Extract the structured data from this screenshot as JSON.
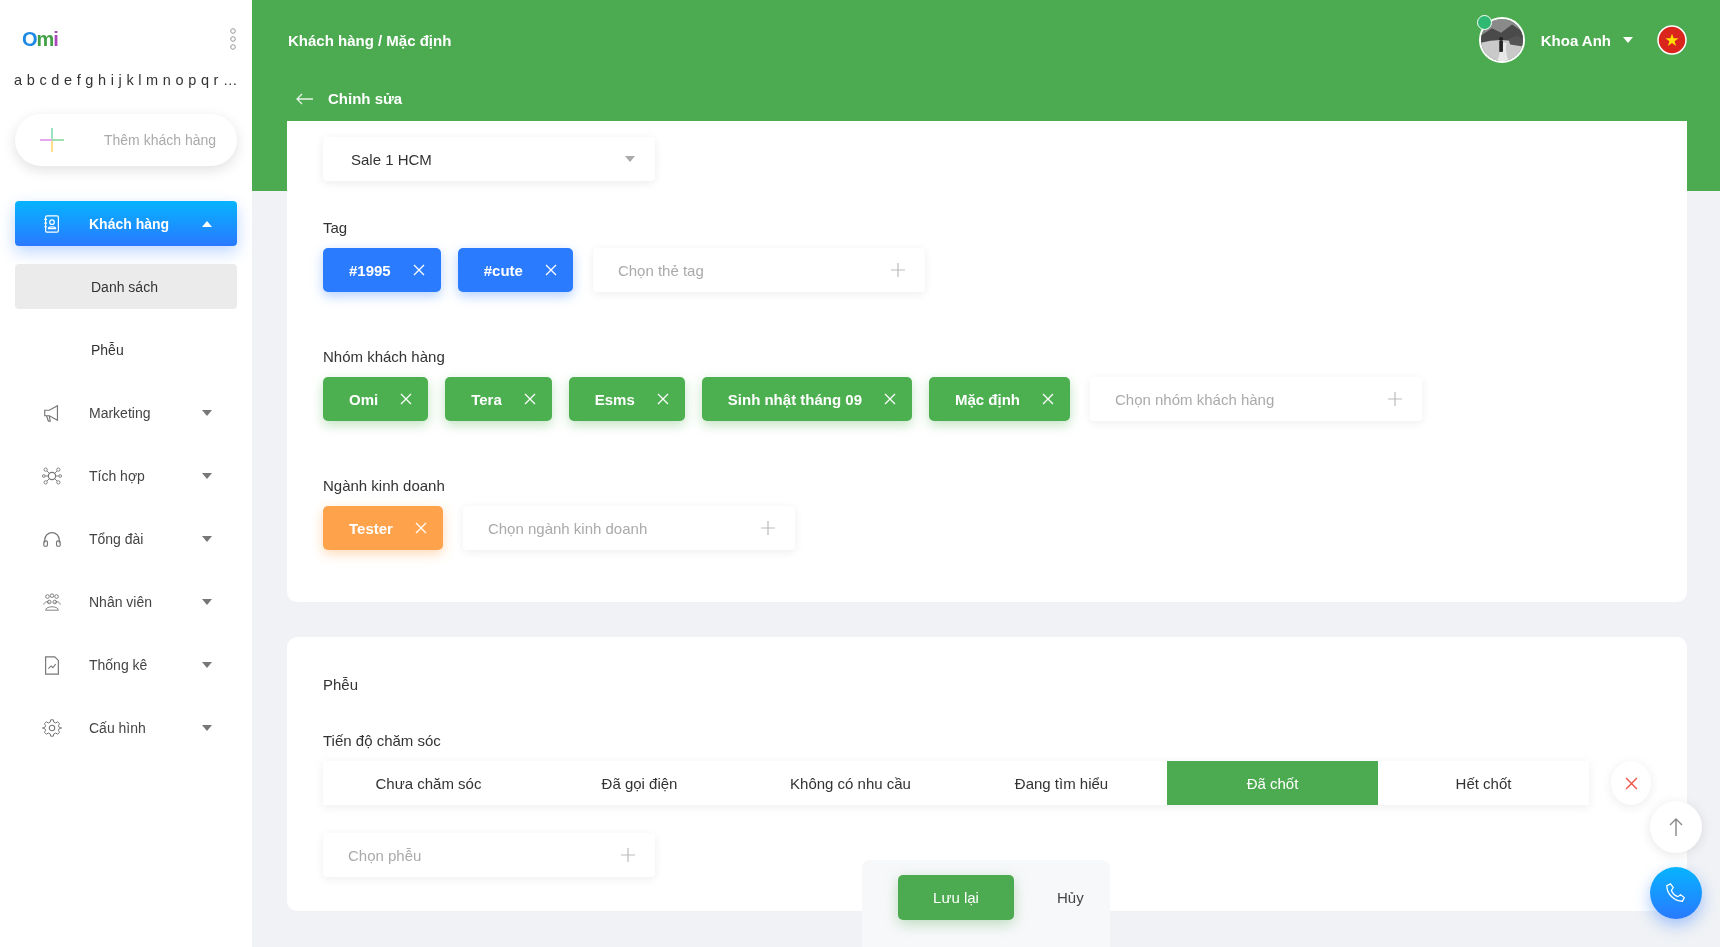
{
  "sidebar": {
    "logo": "Omi",
    "alphabet": "a b c d e f g h i j k l m n o p q r …",
    "add_button": "Thêm khách hàng",
    "nav": [
      {
        "label": "Khách hàng",
        "selected": true,
        "expanded": true,
        "children": [
          {
            "label": "Danh sách",
            "selected": true
          },
          {
            "label": "Phễu",
            "selected": false
          }
        ]
      },
      {
        "label": "Marketing",
        "selected": false,
        "expanded": false
      },
      {
        "label": "Tích hợp",
        "selected": false,
        "expanded": false
      },
      {
        "label": "Tổng đài",
        "selected": false,
        "expanded": false
      },
      {
        "label": "Nhân viên",
        "selected": false,
        "expanded": false
      },
      {
        "label": "Thống kê",
        "selected": false,
        "expanded": false
      },
      {
        "label": "Cấu hình",
        "selected": false,
        "expanded": false
      }
    ]
  },
  "header": {
    "breadcrumb": "Khách hàng / Mặc định",
    "user": {
      "name": "Khoa Anh",
      "online": true
    },
    "page_title": "Chỉnh sửa"
  },
  "customer_card": {
    "owner_select": {
      "value": "Sale 1 HCM"
    },
    "sections": [
      {
        "label": "Tag",
        "kind": "tag",
        "chips": [
          "#1995",
          "#cute"
        ],
        "placeholder": "Chọn thẻ tag"
      },
      {
        "label": "Nhóm khách hàng",
        "kind": "group",
        "chips": [
          "Omi",
          "Tera",
          "Esms",
          "Sinh nhật tháng 09",
          "Mặc định"
        ],
        "placeholder": "Chọn nhóm khách hàng"
      },
      {
        "label": "Ngành kinh doanh",
        "kind": "industry",
        "chips": [
          "Tester"
        ],
        "placeholder": "Chọn ngành kinh doanh"
      }
    ]
  },
  "funnel_card": {
    "title": "Phễu",
    "progress_label": "Tiến độ chăm sóc",
    "stages": [
      {
        "label": "Chưa chăm sóc",
        "selected": false
      },
      {
        "label": "Đã gọi điện",
        "selected": false
      },
      {
        "label": "Không có nhu cầu",
        "selected": false
      },
      {
        "label": "Đang tìm hiểu",
        "selected": false
      },
      {
        "label": "Đã chốt",
        "selected": true
      },
      {
        "label": "Hết chốt",
        "selected": false
      }
    ],
    "funnel_select": {
      "placeholder": "Chọn phễu"
    }
  },
  "actions": {
    "save": "Lưu lại",
    "cancel": "Hủy"
  }
}
